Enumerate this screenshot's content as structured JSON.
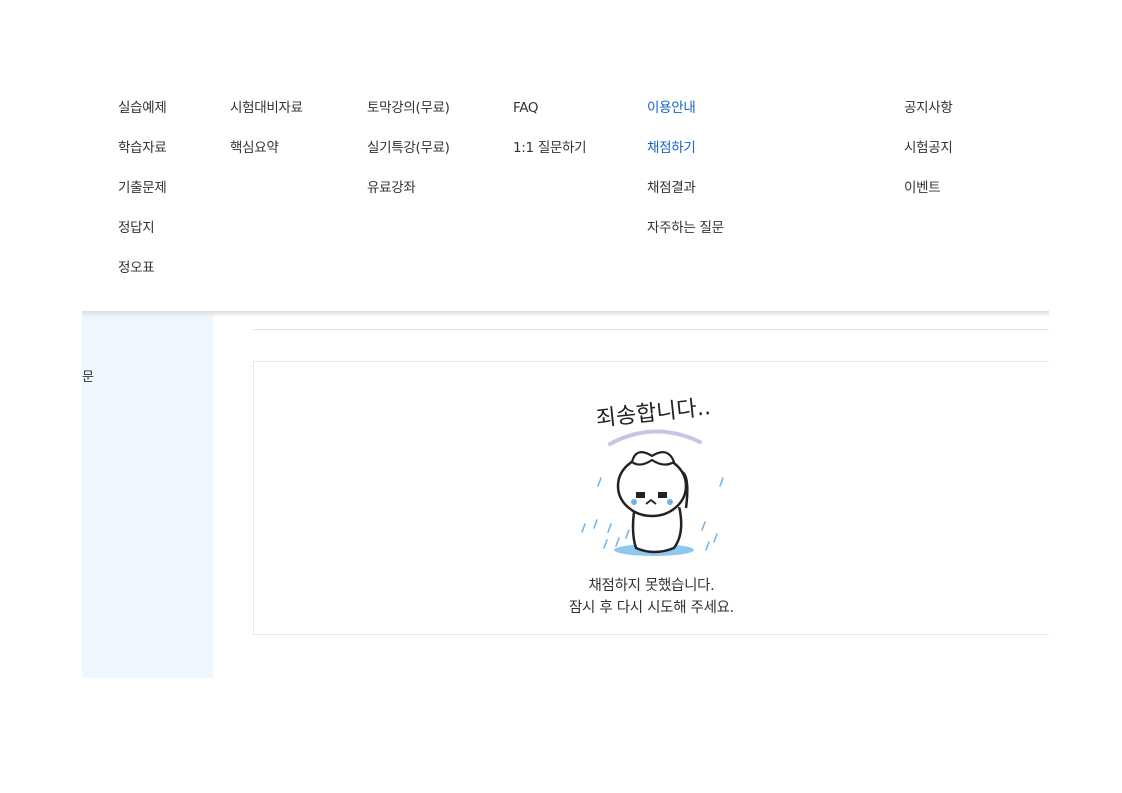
{
  "menu": {
    "columns": [
      {
        "items": [
          {
            "label": "실습예제"
          },
          {
            "label": "학습자료"
          },
          {
            "label": "기출문제"
          },
          {
            "label": "정답지"
          },
          {
            "label": "정오표"
          }
        ]
      },
      {
        "items": [
          {
            "label": "시험대비자료"
          },
          {
            "label": "핵심요약"
          }
        ]
      },
      {
        "items": [
          {
            "label": "토막강의(무료)"
          },
          {
            "label": "실기특강(무료)"
          },
          {
            "label": "유료강좌"
          }
        ]
      },
      {
        "items": [
          {
            "label": "FAQ"
          },
          {
            "label": "1:1 질문하기"
          }
        ]
      },
      {
        "items": [
          {
            "label": "이용안내"
          },
          {
            "label": "채점하기"
          },
          {
            "label": "채점결과"
          },
          {
            "label": "자주하는 질문"
          }
        ]
      },
      {
        "items": [
          {
            "label": "공지사항"
          },
          {
            "label": "시험공지"
          },
          {
            "label": "이벤트"
          }
        ]
      }
    ],
    "active_color": "#1a62c6"
  },
  "sidebar": {
    "partial_text": "문",
    "background": "#eef6ff"
  },
  "message": {
    "illustration_text": "죄송합니다..",
    "line1": "채점하지 못했습니다.",
    "line2": "잠시 후 다시 시도해 주세요."
  }
}
